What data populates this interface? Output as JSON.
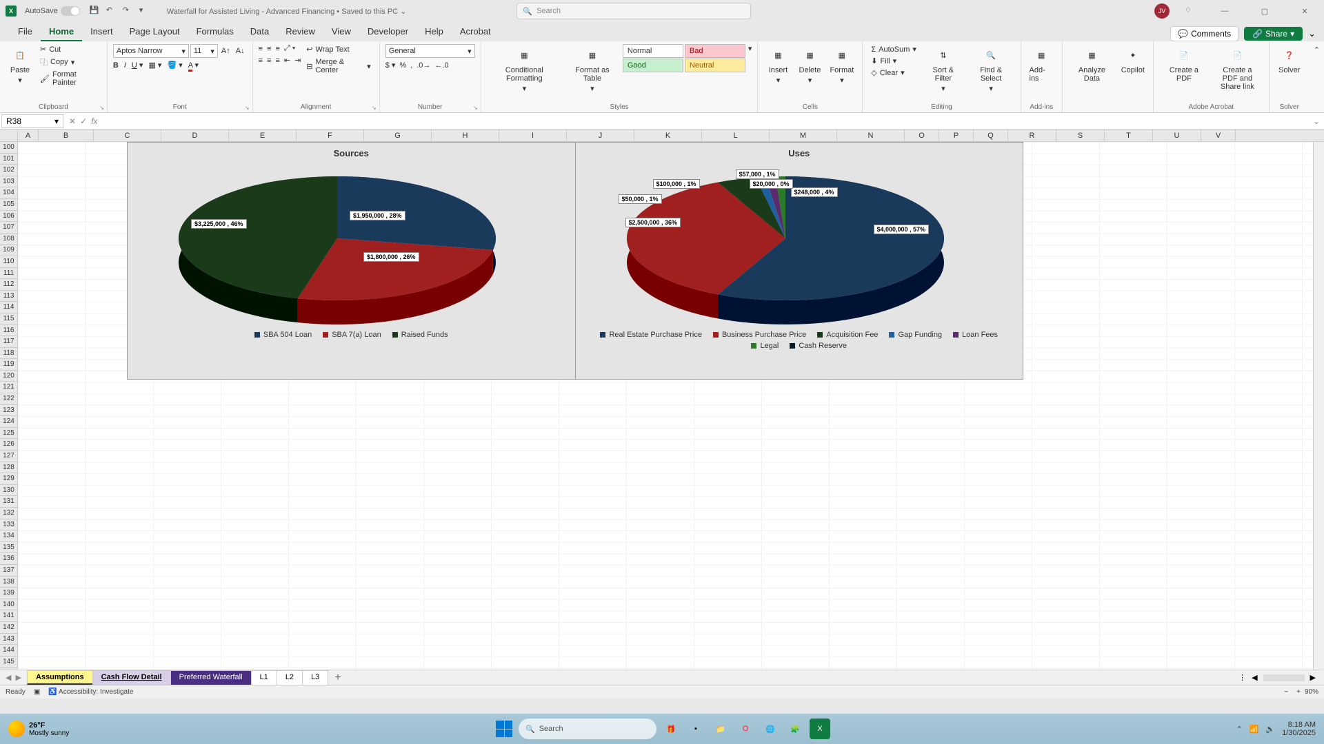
{
  "titlebar": {
    "autosave_label": "AutoSave",
    "autosave_state": "Off",
    "doc_title": "Waterfall for Assisted Living - Advanced Financing • Saved to this PC ⌄",
    "search_placeholder": "Search",
    "avatar_initials": "JV"
  },
  "ribbon_tabs": [
    "File",
    "Home",
    "Insert",
    "Page Layout",
    "Formulas",
    "Data",
    "Review",
    "View",
    "Developer",
    "Help",
    "Acrobat"
  ],
  "active_tab": "Home",
  "comments_btn": "Comments",
  "share_btn": "Share",
  "clipboard": {
    "paste": "Paste",
    "cut": "Cut",
    "copy": "Copy",
    "format_painter": "Format Painter",
    "label": "Clipboard"
  },
  "font": {
    "name": "Aptos Narrow",
    "size": "11",
    "label": "Font"
  },
  "alignment": {
    "wrap": "Wrap Text",
    "merge": "Merge & Center",
    "label": "Alignment"
  },
  "number": {
    "format": "General",
    "label": "Number"
  },
  "styles": {
    "cf": "Conditional Formatting",
    "fat": "Format as Table",
    "normal": "Normal",
    "bad": "Bad",
    "good": "Good",
    "neutral": "Neutral",
    "label": "Styles"
  },
  "cells": {
    "insert": "Insert",
    "delete": "Delete",
    "format": "Format",
    "label": "Cells"
  },
  "editing": {
    "autosum": "AutoSum",
    "fill": "Fill",
    "clear": "Clear",
    "sort": "Sort & Filter",
    "find": "Find & Select",
    "label": "Editing"
  },
  "addins": {
    "addins": "Add-ins",
    "label": "Add-ins"
  },
  "analyze": {
    "analyze": "Analyze Data",
    "copilot": "Copilot"
  },
  "acrobat": {
    "create": "Create a PDF",
    "share": "Create a PDF and Share link",
    "label": "Adobe Acrobat"
  },
  "solver": {
    "solver": "Solver",
    "label": "Solver"
  },
  "namebox": "R38",
  "columns": [
    "A",
    "B",
    "C",
    "D",
    "E",
    "F",
    "G",
    "H",
    "I",
    "J",
    "K",
    "L",
    "M",
    "N",
    "O",
    "P",
    "Q",
    "R",
    "S",
    "T",
    "U",
    "V"
  ],
  "row_start": 100,
  "row_end": 145,
  "chart_data": [
    {
      "type": "pie",
      "title": "Sources",
      "series": [
        {
          "name": "SBA 504 Loan",
          "value": 1950000,
          "pct": 28,
          "color": "#1a3a5c",
          "label": "$1,950,000 , 28%"
        },
        {
          "name": "SBA 7(a) Loan",
          "value": 1800000,
          "pct": 26,
          "color": "#a02020",
          "label": "$1,800,000 , 26%"
        },
        {
          "name": "Raised Funds",
          "value": 3225000,
          "pct": 46,
          "color": "#1a3a1a",
          "label": "$3,225,000 , 46%"
        }
      ]
    },
    {
      "type": "pie",
      "title": "Uses",
      "series": [
        {
          "name": "Real Estate Purchase Price",
          "value": 4000000,
          "pct": 57,
          "color": "#1a3a5c",
          "label": "$4,000,000 , 57%"
        },
        {
          "name": "Business Purchase Price",
          "value": 2500000,
          "pct": 36,
          "color": "#a02020",
          "label": "$2,500,000 , 36%"
        },
        {
          "name": "Acquisition Fee",
          "value": 248000,
          "pct": 4,
          "color": "#1a3a1a",
          "label": "$248,000 , 4%"
        },
        {
          "name": "Gap Funding",
          "value": 100000,
          "pct": 1,
          "color": "#2060a0",
          "label": "$100,000 , 1%"
        },
        {
          "name": "Loan Fees",
          "value": 57000,
          "pct": 1,
          "color": "#5a2a6a",
          "label": "$57,000 , 1%"
        },
        {
          "name": "Legal",
          "value": 50000,
          "pct": 1,
          "color": "#2a7a2a",
          "label": "$50,000 , 1%"
        },
        {
          "name": "Cash Reserve",
          "value": 20000,
          "pct": 0,
          "color": "#0a1a2a",
          "label": "$20,000 , 0%"
        }
      ]
    }
  ],
  "sheets": [
    {
      "name": "Assumptions",
      "cls": "assumptions"
    },
    {
      "name": "Cash Flow Detail",
      "cls": "cashflow"
    },
    {
      "name": "Preferred Waterfall",
      "cls": "preferred"
    },
    {
      "name": "L1",
      "cls": ""
    },
    {
      "name": "L2",
      "cls": ""
    },
    {
      "name": "L3",
      "cls": ""
    }
  ],
  "status": {
    "ready": "Ready",
    "accessibility": "Accessibility: Investigate",
    "zoom": "90%"
  },
  "taskbar": {
    "temp": "26°F",
    "weather": "Mostly sunny",
    "search": "Search",
    "time": "8:18 AM",
    "date": "1/30/2025"
  }
}
